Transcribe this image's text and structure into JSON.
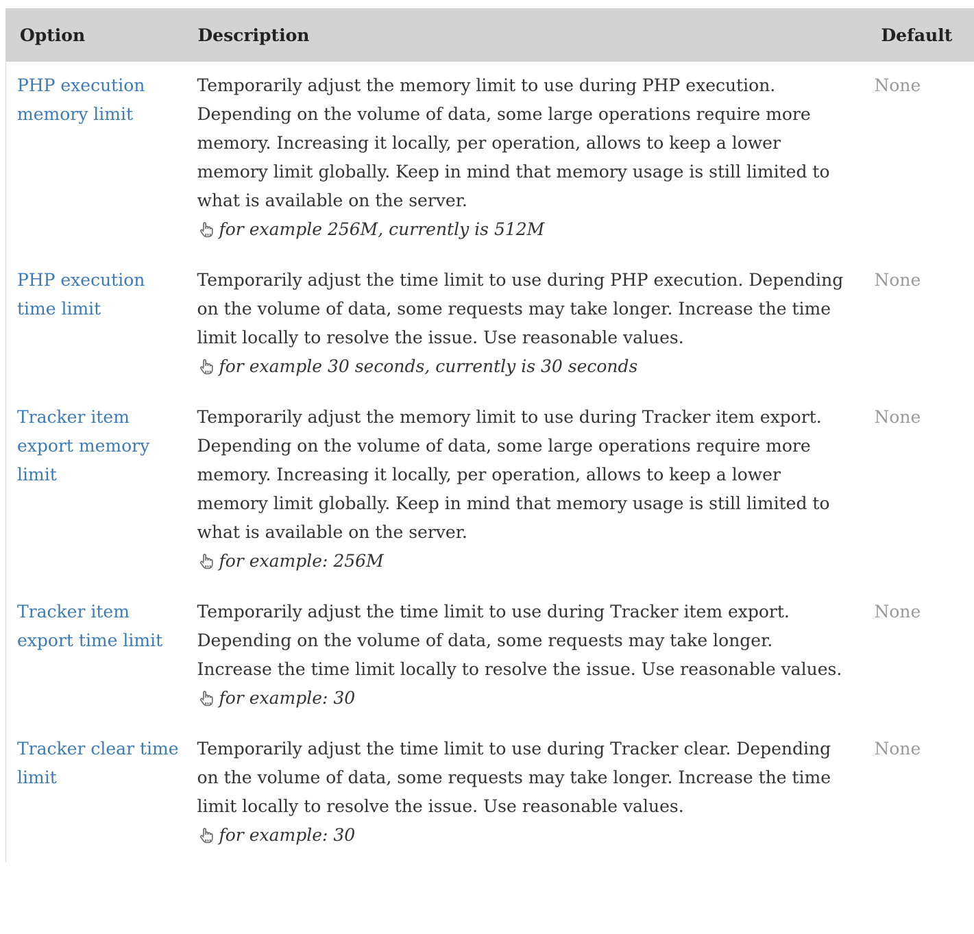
{
  "table": {
    "headers": {
      "option": "Option",
      "description": "Description",
      "default": "Default"
    },
    "rows": [
      {
        "option": "PHP execution memory limit",
        "description": "Temporarily adjust the memory limit to use during PHP execution. Depending on the volume of data, some large operations require more memory. Increasing it locally, per operation, allows to keep a lower memory limit globally. Keep in mind that memory usage is still limited to what is available on the server.",
        "hint": "for example 256M, currently is 512M",
        "default": "None"
      },
      {
        "option": "PHP execution time limit",
        "description": "Temporarily adjust the time limit to use during PHP execution. Depending on the volume of data, some requests may take longer. Increase the time limit locally to resolve the issue. Use reasonable values.",
        "hint": "for example 30 seconds, currently is 30 seconds",
        "default": "None"
      },
      {
        "option": "Tracker item export memory limit",
        "description": "Temporarily adjust the memory limit to use during Tracker item export. Depending on the volume of data, some large operations require more memory. Increasing it locally, per operation, allows to keep a lower memory limit globally. Keep in mind that memory usage is still limited to what is available on the server.",
        "hint": "for example: 256M",
        "default": "None"
      },
      {
        "option": "Tracker item export time limit",
        "description": "Temporarily adjust the time limit to use during Tracker item export. Depending on the volume of data, some requests may take longer. Increase the time limit locally to resolve the issue. Use reasonable values.",
        "hint": "for example: 30",
        "default": "None"
      },
      {
        "option": "Tracker clear time limit",
        "description": "Temporarily adjust the time limit to use during Tracker clear. Depending on the volume of data, some requests may take longer. Increase the time limit locally to resolve the issue. Use reasonable values.",
        "hint": "for example: 30",
        "default": "None"
      }
    ]
  },
  "icons": {
    "hint": "hand-pointer-icon"
  },
  "colors": {
    "link": "#3d7ab8",
    "header_bg": "#d3d3d3",
    "default_text": "#999999"
  }
}
